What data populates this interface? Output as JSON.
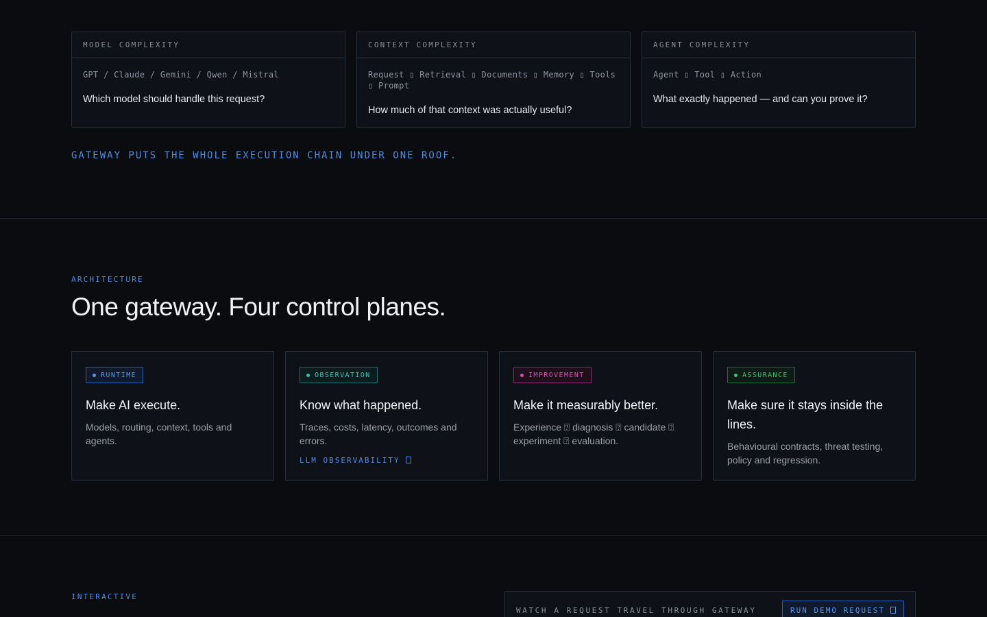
{
  "complexity": [
    {
      "heading": "MODEL COMPLEXITY",
      "path": "GPT / Claude / Gemini / Qwen / Mistral",
      "question": "Which model should handle this request?"
    },
    {
      "heading": "CONTEXT COMPLEXITY",
      "path": "Request ▯ Retrieval ▯ Documents ▯ Memory ▯ Tools ▯ Prompt",
      "question": "How much of that context was actually useful?"
    },
    {
      "heading": "AGENT COMPLEXITY",
      "path": "Agent ▯ Tool ▯ Action",
      "question": "What exactly happened — and can you prove it?"
    }
  ],
  "roof_statement": "GATEWAY PUTS THE WHOLE EXECUTION CHAIN UNDER ONE ROOF.",
  "architecture": {
    "eyebrow": "ARCHITECTURE",
    "headline": "One gateway. Four control planes.",
    "planes": [
      {
        "badge": "RUNTIME",
        "title": "Make AI execute.",
        "desc": "Models, routing, context, tools and agents.",
        "color": "#5b95ea"
      },
      {
        "badge": "OBSERVATION",
        "title": "Know what happened.",
        "desc": "Traces, costs, latency, outcomes and errors.",
        "link": "LLM OBSERVABILITY",
        "color": "#3cc2b8"
      },
      {
        "badge": "IMPROVEMENT",
        "title": "Make it measurably better.",
        "desc": "Experience ⍰ diagnosis ⍰ candidate ⍰ experiment ⍰ evaluation.",
        "color": "#e24cb4"
      },
      {
        "badge": "ASSURANCE",
        "title": "Make sure it stays inside the lines.",
        "desc": "Behavioural contracts, threat testing, policy and regression.",
        "color": "#3fc478"
      }
    ]
  },
  "interactive": {
    "eyebrow": "INTERACTIVE",
    "demo_label": "WATCH A REQUEST TRAVEL THROUGH GATEWAY",
    "demo_button": "RUN DEMO REQUEST"
  }
}
